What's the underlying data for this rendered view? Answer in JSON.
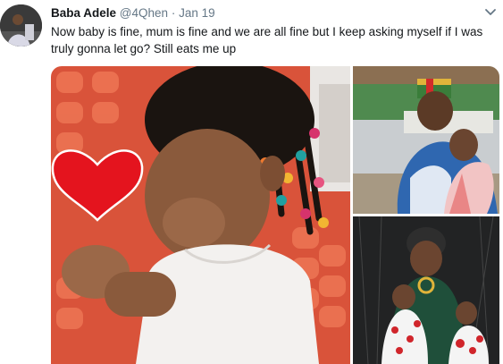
{
  "tweet": {
    "author_name": "Baba Adele",
    "author_handle": "@4Qhen",
    "separator": "·",
    "date": "Jan 19",
    "text": "Now baby is fine, mum is fine and we are all fine but I keep asking myself if I was truly gonna let go? Still eats me up"
  },
  "icons": {
    "more": "chevron-down-icon",
    "avatar": "profile-avatar",
    "heart": "heart-sticker-icon"
  },
  "colors": {
    "text": "#14171a",
    "secondary": "#657786",
    "heart": "#e4141e",
    "chair_orange": "#e5532d"
  }
}
